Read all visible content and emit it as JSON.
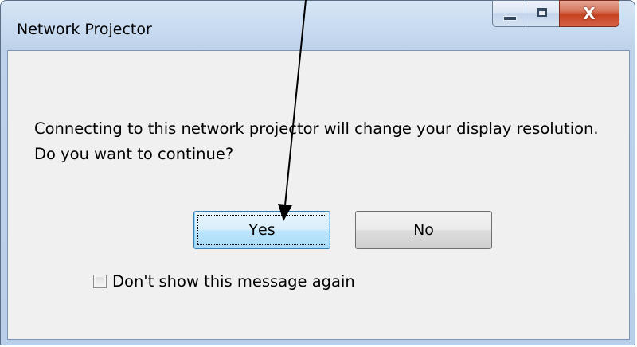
{
  "window": {
    "title": "Network Projector",
    "close_glyph": "X",
    "icons": [
      "minimize-icon",
      "maximize-icon",
      "close-icon"
    ]
  },
  "dialog": {
    "message": "Connecting to this network projector will change your display resolution.  Do you want to continue?",
    "yes_button": {
      "mnemonic": "Y",
      "rest": "es"
    },
    "no_button": {
      "mnemonic": "N",
      "rest": "o"
    },
    "checkbox_label": "Don't show this message again",
    "checkbox_checked": false
  },
  "colors": {
    "frame": "#b9cee8",
    "client": "#f0f0f0",
    "close_button": "#c6421f",
    "default_button": "#bee6fd"
  }
}
